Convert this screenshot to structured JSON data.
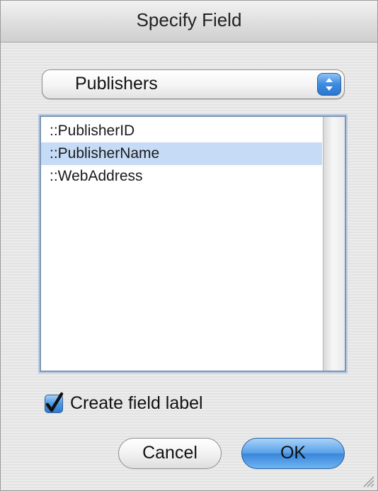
{
  "dialog": {
    "title": "Specify Field"
  },
  "table_popup": {
    "selected": "Publishers"
  },
  "fields": [
    {
      "label": "::PublisherID",
      "selected": false
    },
    {
      "label": "::PublisherName",
      "selected": true
    },
    {
      "label": "::WebAddress",
      "selected": false
    }
  ],
  "create_label": {
    "label": "Create field label",
    "checked": true
  },
  "buttons": {
    "cancel": "Cancel",
    "ok": "OK"
  },
  "colors": {
    "selection": "#c6dbf6",
    "accent": "#3a86da"
  }
}
